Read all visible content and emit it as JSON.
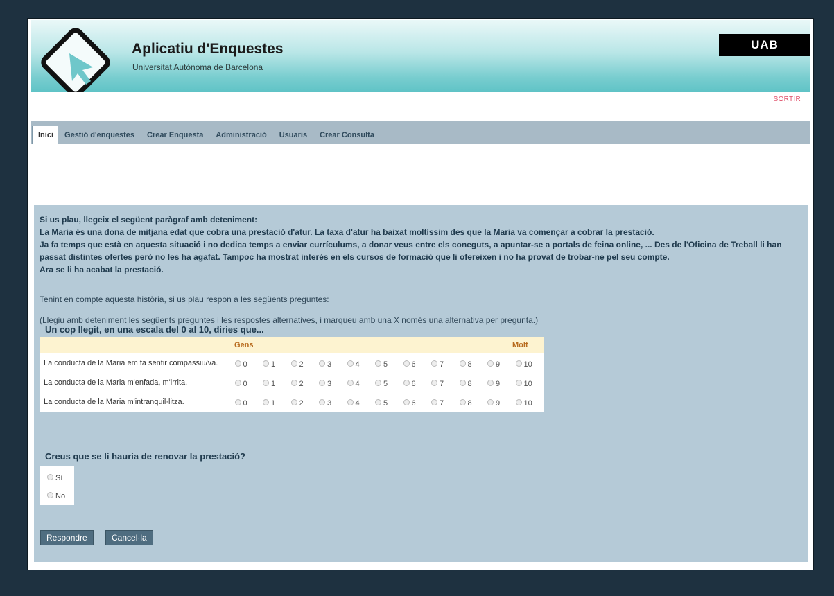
{
  "header": {
    "title": "Aplicatiu d'Enquestes",
    "subtitle": "Universitat Autònoma de Barcelona",
    "brand": "UAB",
    "logout": "SORTIR"
  },
  "nav": {
    "items": [
      {
        "label": "Inici"
      },
      {
        "label": "Gestió d'enquestes"
      },
      {
        "label": "Crear Enquesta"
      },
      {
        "label": "Administració"
      },
      {
        "label": "Usuaris"
      },
      {
        "label": "Crear Consulta"
      }
    ]
  },
  "intro": {
    "heading": "Si us plau, llegeix el següent paràgraf amb deteniment:",
    "p1": "La Maria és una dona de mitjana edat que cobra una prestació d'atur. La taxa d'atur ha baixat moltíssim des que la Maria va començar a cobrar la prestació.",
    "p2": "Ja fa temps que està en aquesta situació i no dedica temps a enviar currículums, a donar veus entre els coneguts, a apuntar-se a portals de feina online, ... Des de l'Oficina de Treball li han passat distintes ofertes però no les ha agafat. Tampoc ha mostrat interès en els cursos de formació que li ofereixen i no ha provat de trobar-ne pel seu compte.",
    "p3": "Ara se li ha acabat la prestació.",
    "note1": "Tenint en compte aquesta història, si us plau respon a les següents preguntes:",
    "note2": "(Llegiu amb deteniment les següents preguntes i les respostes alternatives, i marqueu amb una X només una alternativa per pregunta.)"
  },
  "question1": {
    "title": "Un cop llegit, en una escala del 0 al 10, diries que...",
    "low_label": "Gens",
    "high_label": "Molt",
    "options": [
      "0",
      "1",
      "2",
      "3",
      "4",
      "5",
      "6",
      "7",
      "8",
      "9",
      "10"
    ],
    "rows": [
      {
        "label": "La conducta de la Maria em fa sentir compassiu/va."
      },
      {
        "label": "La conducta de la Maria m'enfada, m'irrita."
      },
      {
        "label": "La conducta de la Maria m'intranquil·litza."
      }
    ]
  },
  "question2": {
    "title": "Creus que se li hauria de renovar la prestació?",
    "options": [
      "Sí",
      "No"
    ]
  },
  "buttons": {
    "submit": "Respondre",
    "cancel": "Cancel·la"
  }
}
